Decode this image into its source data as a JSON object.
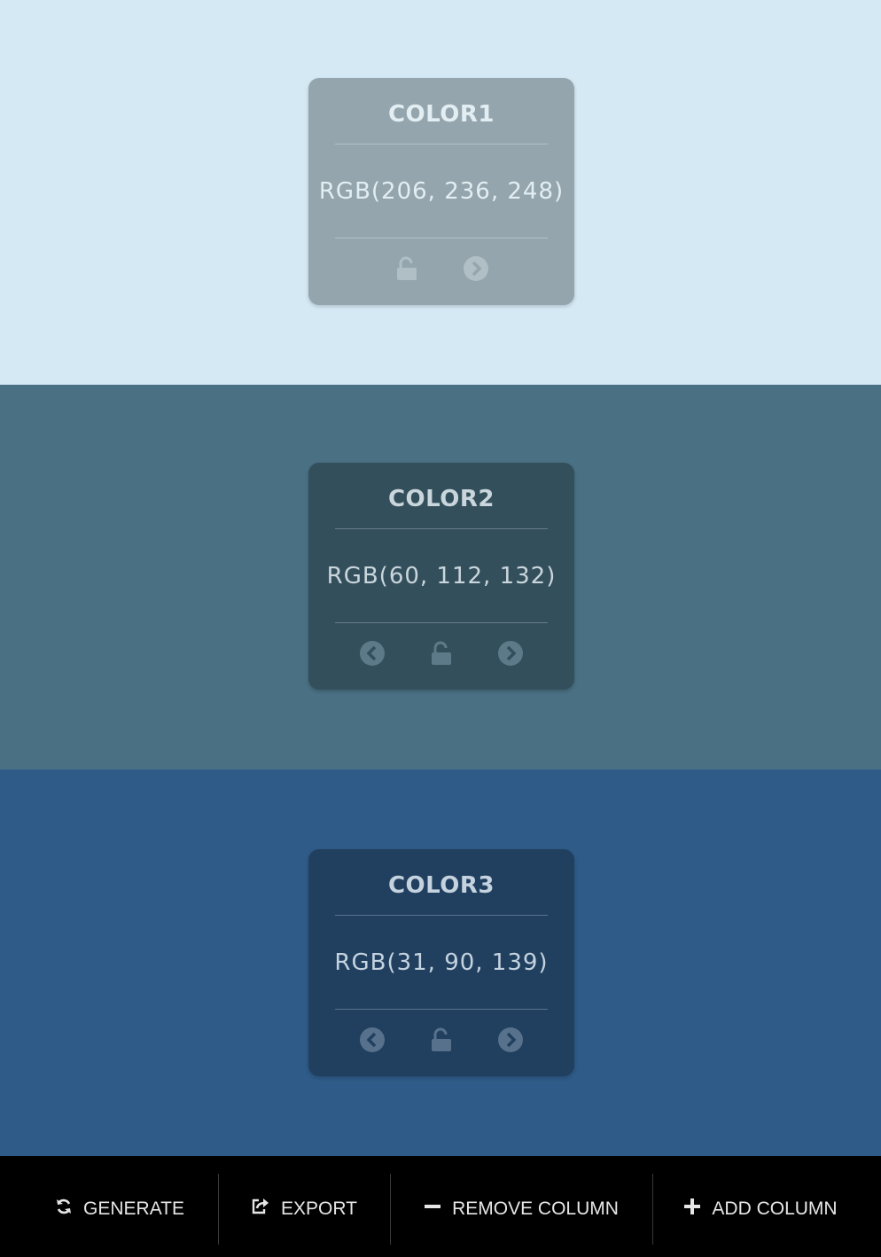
{
  "colors": [
    {
      "title": "COLOR1",
      "rgb": "RGB(206, 236, 248)",
      "background": "#d5e9f5",
      "card_bg": "#94a5ad",
      "text_color": "#e3eef3",
      "divider_color": "#b3c2c8",
      "icon_color": "#b0bfc5",
      "controls": [
        "unlock-icon",
        "next-icon"
      ]
    },
    {
      "title": "COLOR2",
      "rgb": "RGB(60, 112, 132)",
      "background": "#4a7083",
      "card_bg": "#344f5c",
      "text_color": "#c9d6dc",
      "divider_color": "#667d88",
      "icon_color": "#5d7a88",
      "controls": [
        "previous-icon",
        "unlock-icon",
        "next-icon"
      ]
    },
    {
      "title": "COLOR3",
      "rgb": "RGB(31, 90, 139)",
      "background": "#2f5b88",
      "card_bg": "#21405f",
      "text_color": "#c5d3e0",
      "divider_color": "#58728d",
      "icon_color": "#57718c",
      "controls": [
        "previous-icon",
        "unlock-icon",
        "next-icon"
      ]
    }
  ],
  "toolbar": {
    "generate_label": "GENERATE",
    "export_label": "EXPORT",
    "remove_column_label": "REMOVE COLUMN",
    "add_column_label": "ADD COLUMN"
  }
}
